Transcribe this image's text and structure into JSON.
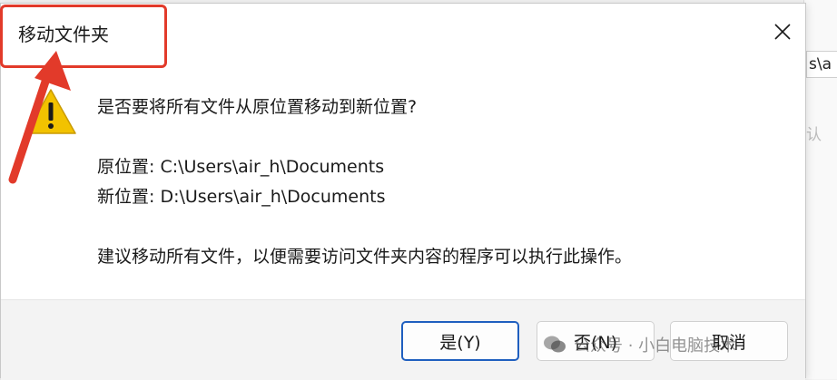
{
  "background": {
    "path_fragment": "s\\a",
    "text_fragment": "认"
  },
  "dialog": {
    "title": "移动文件夹",
    "question": "是否要将所有文件从原位置移动到新位置?",
    "original_location": "原位置: C:\\Users\\air_h\\Documents",
    "new_location": "新位置: D:\\Users\\air_h\\Documents",
    "advice": "建议移动所有文件，以便需要访问文件夹内容的程序可以执行此操作。",
    "buttons": {
      "yes": "是(Y)",
      "no": "否(N)",
      "cancel": "取消"
    },
    "icons": {
      "warning": "warning-icon",
      "close": "close-icon"
    }
  },
  "watermark": "公众号 · 小白电脑技术",
  "colors": {
    "annotation": "#e23a2a",
    "default_button_border": "#1f5fbf",
    "warning_yellow": "#f2c200"
  }
}
